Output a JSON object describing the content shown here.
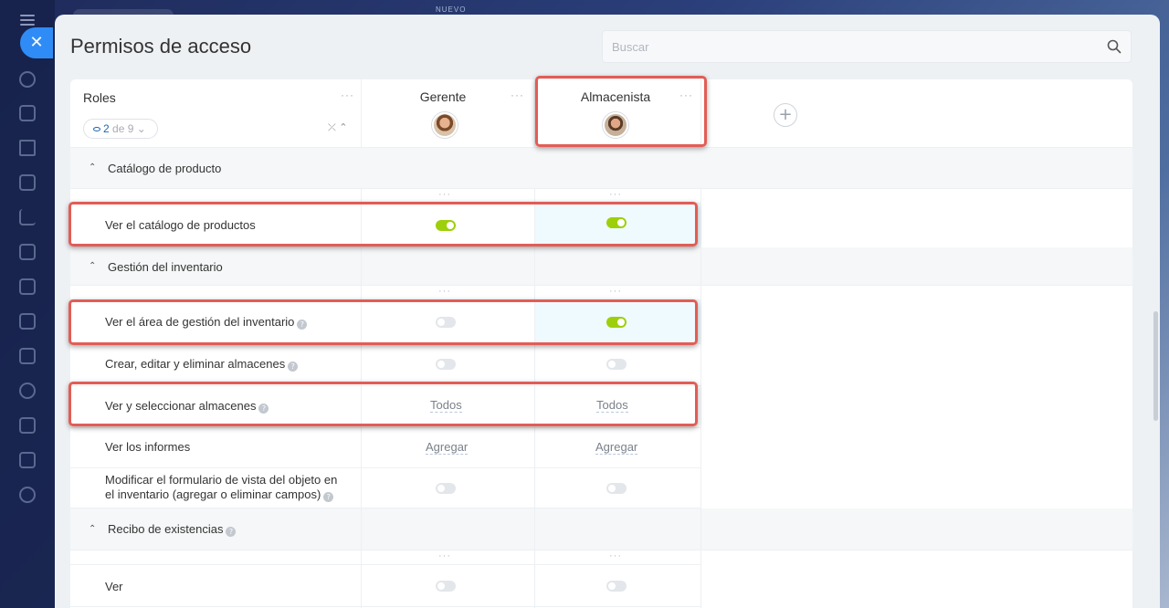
{
  "app": {
    "top_label": "NUEVO"
  },
  "panel": {
    "title": "Permisos de acceso"
  },
  "search": {
    "placeholder": "Buscar"
  },
  "roles_header": {
    "label": "Roles",
    "filter_count": "2",
    "filter_of": "de 9"
  },
  "roles": [
    {
      "name": "Gerente"
    },
    {
      "name": "Almacenista"
    }
  ],
  "sections": [
    {
      "label": "Catálogo de producto",
      "rows": [
        {
          "label": "Ver el catálogo de productos",
          "gerente": true,
          "almacenista": true
        }
      ]
    },
    {
      "label": "Gestión del inventario",
      "rows": [
        {
          "label": "Ver el área de gestión del inventario",
          "gerente": false,
          "almacenista": true
        },
        {
          "label": "Crear, editar y eliminar almacenes",
          "gerente": false,
          "almacenista": false
        },
        {
          "label": "Ver y seleccionar almacenes",
          "gerente": "Todos",
          "almacenista": "Todos"
        },
        {
          "label": "Ver los informes",
          "gerente": "Agregar",
          "almacenista": "Agregar"
        },
        {
          "label_line1": "Modificar el formulario de vista del objeto en",
          "label_line2": "el inventario (agregar o eliminar campos)",
          "gerente": false,
          "almacenista": false
        }
      ]
    },
    {
      "label": "Recibo de existencias",
      "rows": [
        {
          "label": "Ver",
          "gerente": false,
          "almacenista": false
        }
      ]
    }
  ],
  "colors": {
    "accent": "#2f8cf6",
    "toggle_on": "#9dcf0b",
    "highlight": "#e25d56"
  }
}
